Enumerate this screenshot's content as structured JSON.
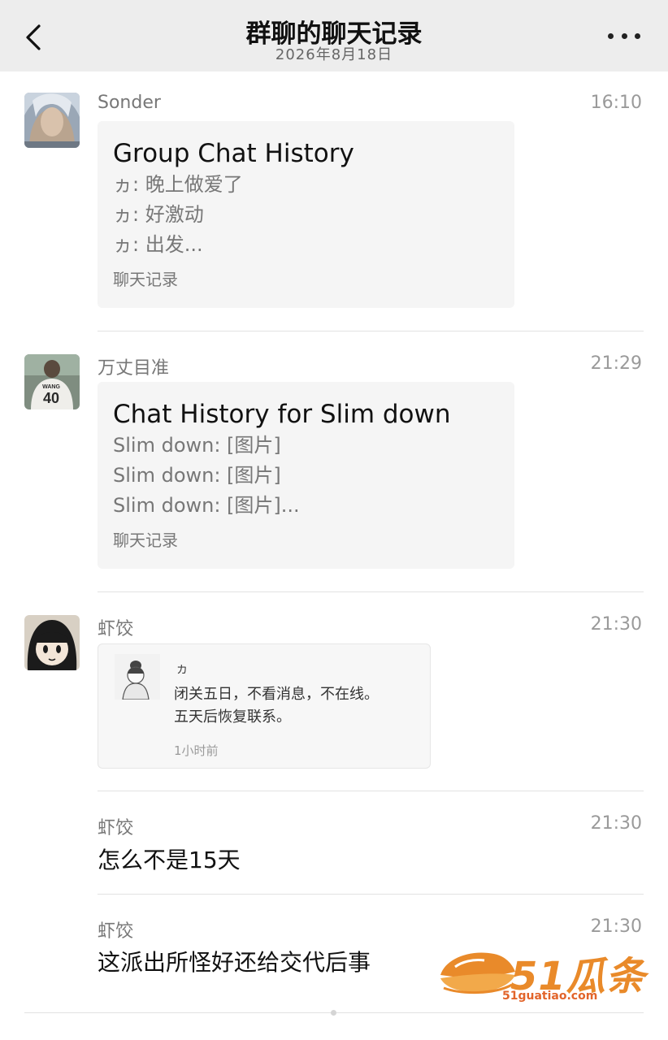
{
  "header": {
    "title": "群聊的聊天记录",
    "subtitle": "2026年8月18日"
  },
  "messages": [
    {
      "sender": "Sonder",
      "time": "16:10",
      "card": {
        "title": "Group Chat History",
        "lines": [
          "ヵ: 晚上做爱了",
          "ヵ: 好激动",
          "ヵ: 出发..."
        ],
        "footer": "聊天记录"
      }
    },
    {
      "sender": "万丈目准",
      "time": "21:29",
      "card": {
        "title": "Chat History for Slim down",
        "lines": [
          "Slim down: [图片]",
          "Slim down: [图片]",
          "Slim down: [图片]..."
        ],
        "footer": "聊天记录"
      }
    },
    {
      "sender": "虾饺",
      "time": "21:30",
      "quote": {
        "name": "ヵ",
        "text": "闭关五日，不看消息，不在线。\n五天后恢复联系。",
        "time": "1小时前"
      }
    },
    {
      "sender": "虾饺",
      "time": "21:30",
      "text": "怎么不是15天"
    },
    {
      "sender": "虾饺",
      "time": "21:30",
      "text": "这派出所怪好还给交代后事"
    }
  ],
  "watermark": {
    "logo_text": "51瓜条",
    "domain": "51guatiao.com"
  },
  "colors": {
    "nav_bg": "#ededed",
    "card_bg": "#f5f5f5",
    "watermark": "#e98a2a"
  }
}
